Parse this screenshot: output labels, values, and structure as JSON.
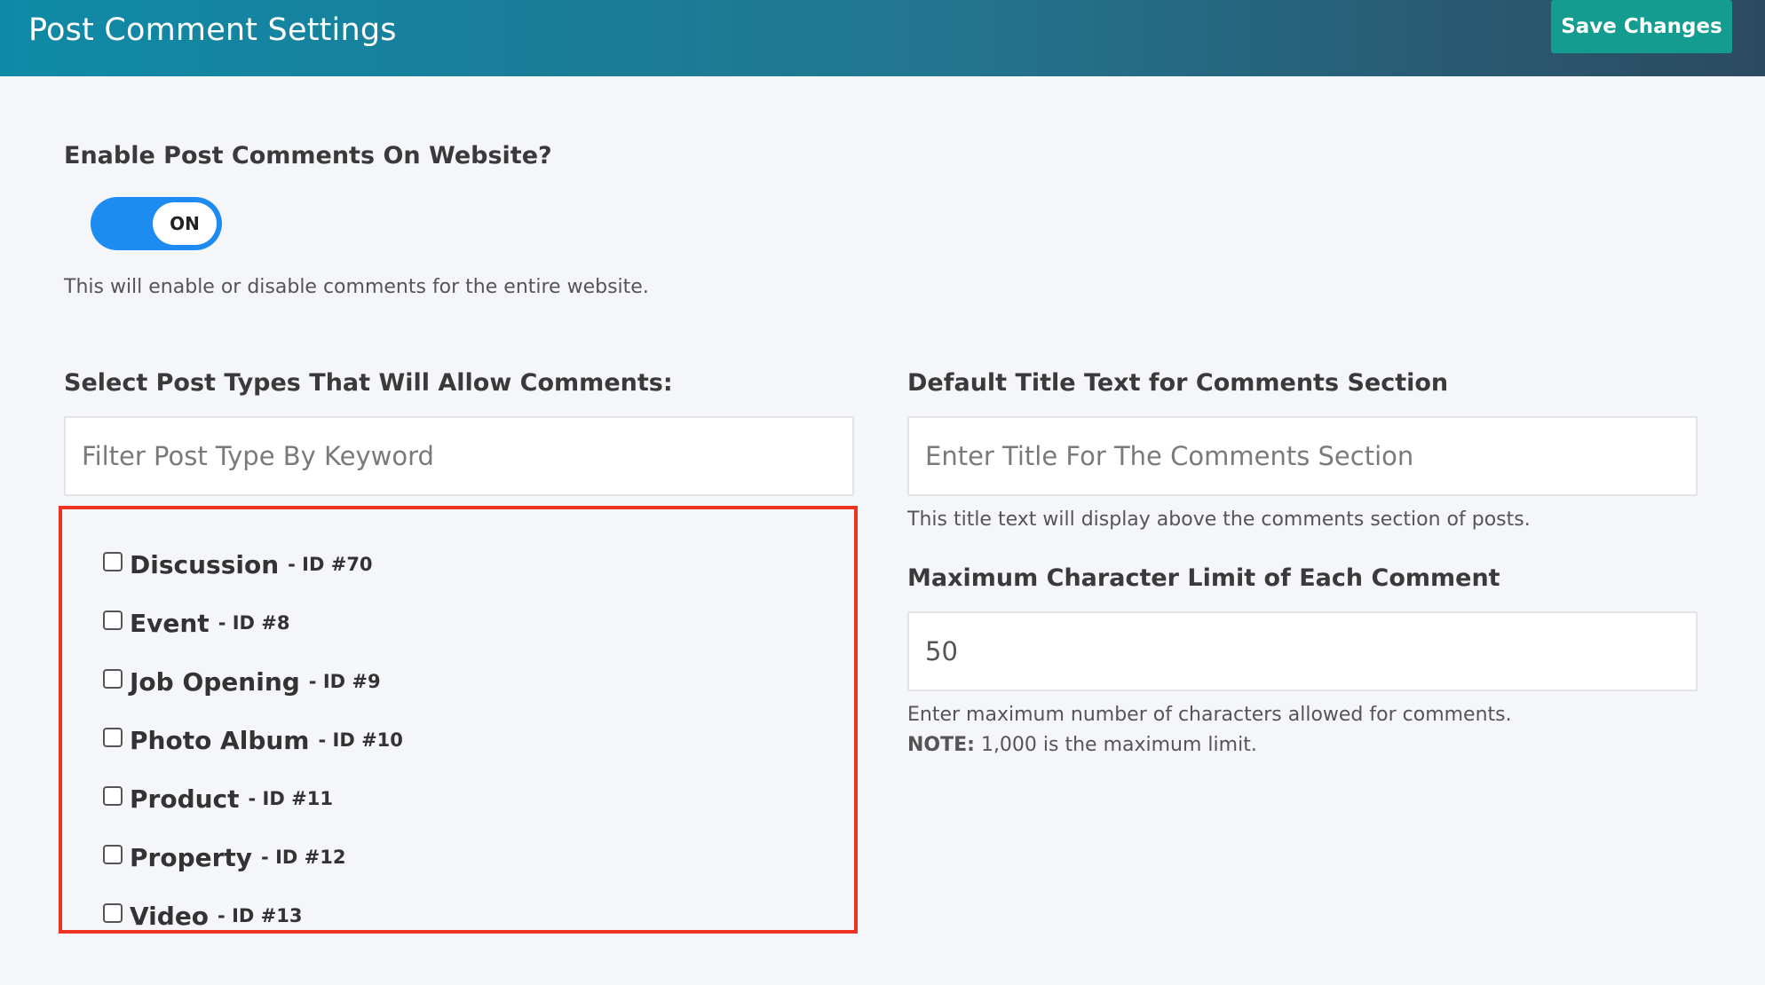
{
  "header": {
    "title": "Post Comment Settings",
    "save_label": "Save Changes"
  },
  "enable": {
    "label": "Enable Post Comments On Website?",
    "toggle_state": "ON",
    "help": "This will enable or disable comments for the entire website."
  },
  "post_types": {
    "label": "Select Post Types That Will Allow Comments:",
    "filter_placeholder": "Filter Post Type By Keyword",
    "items": [
      {
        "name": "Discussion",
        "id": "- ID #70"
      },
      {
        "name": "Event",
        "id": "- ID #8"
      },
      {
        "name": "Job Opening",
        "id": "- ID #9"
      },
      {
        "name": "Photo Album",
        "id": "- ID #10"
      },
      {
        "name": "Product",
        "id": "- ID #11"
      },
      {
        "name": "Property",
        "id": "- ID #12"
      },
      {
        "name": "Video",
        "id": "- ID #13"
      }
    ]
  },
  "title_text": {
    "label": "Default Title Text for Comments Section",
    "placeholder": "Enter Title For The Comments Section",
    "help": "This title text will display above the comments section of posts."
  },
  "char_limit": {
    "label": "Maximum Character Limit of Each Comment",
    "value": "50",
    "help": "Enter maximum number of characters allowed for comments.",
    "note_label": "NOTE:",
    "note_text": " 1,000 is the maximum limit."
  },
  "colors": {
    "header_start": "#0f8aa6",
    "header_end": "#2c4a5f",
    "save_button": "#139c8f",
    "toggle_on": "#1d8bf0",
    "highlight_border": "#ee3322"
  }
}
